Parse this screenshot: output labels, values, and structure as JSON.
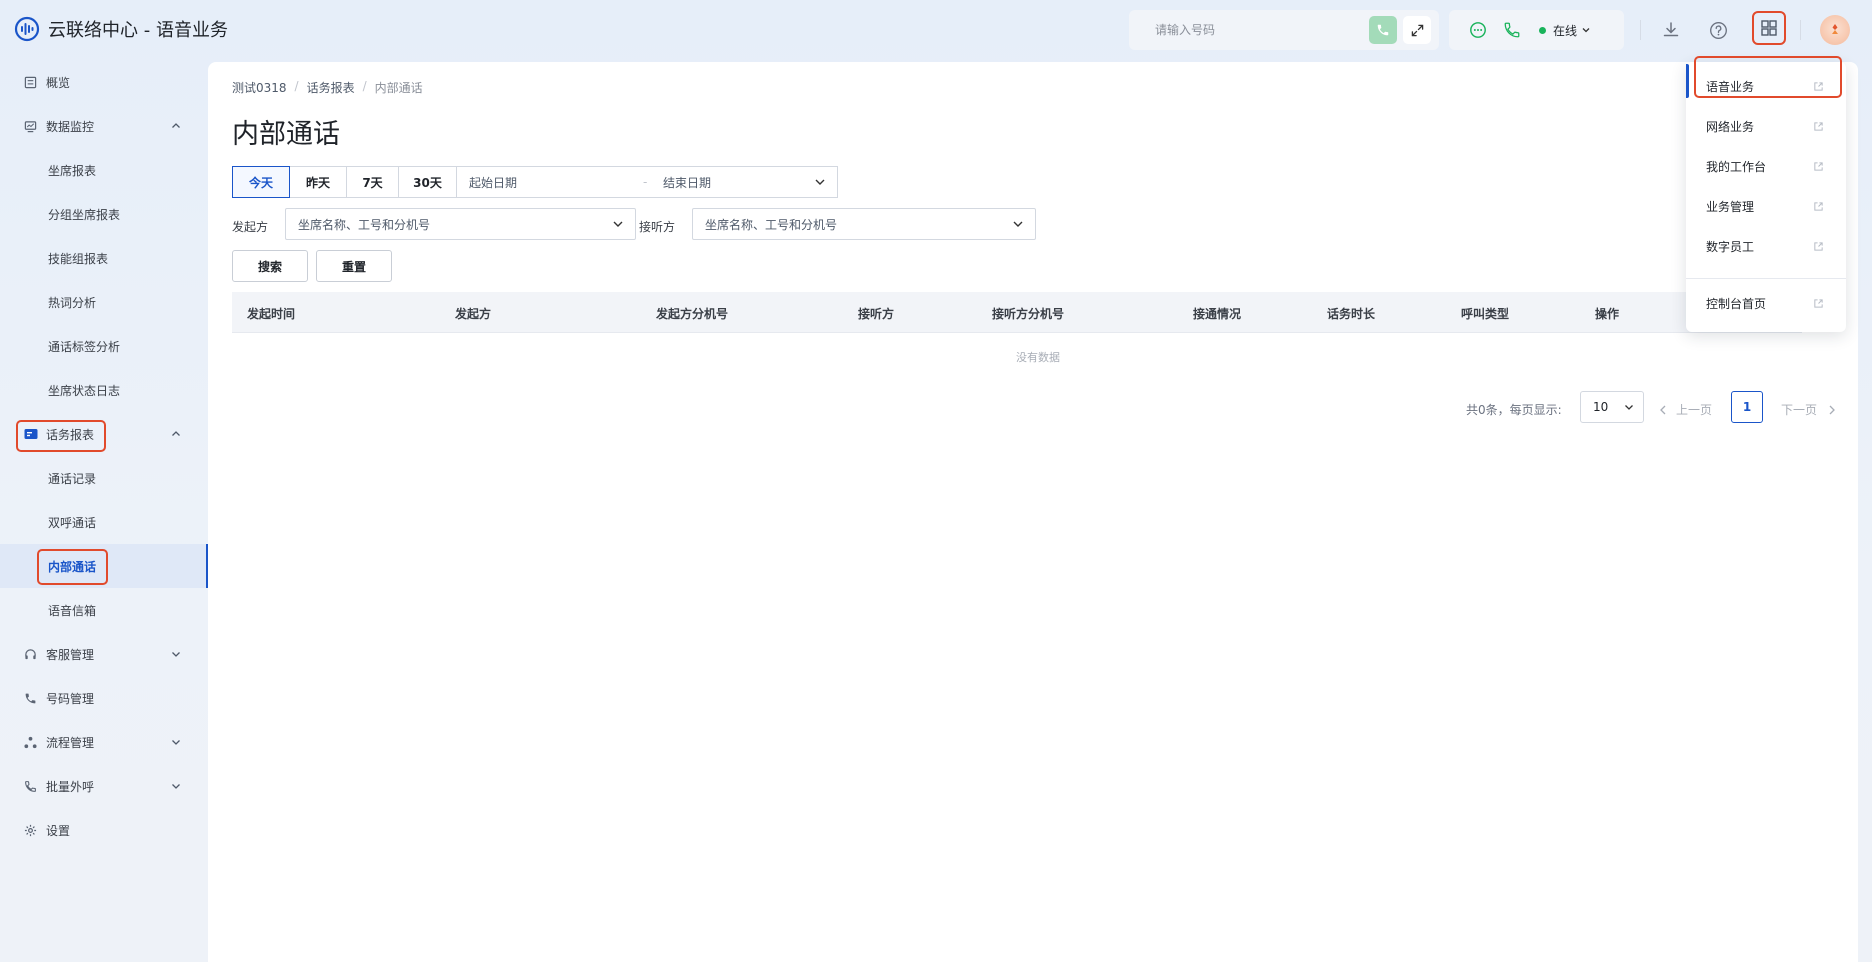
{
  "header": {
    "app_title": "云联络中心 - 语音业务",
    "phone_input": {
      "placeholder": "请输入号码",
      "value": ""
    },
    "status": {
      "label": "在线",
      "color": "#19b35b"
    },
    "icons": [
      "logo-icon",
      "phone-icon",
      "expand-icon",
      "chat-icon",
      "phone-call-icon",
      "chevron-down-icon",
      "download-icon",
      "help-icon",
      "apps-grid-icon",
      "avatar"
    ]
  },
  "sidebar": {
    "items": [
      {
        "label": "概览",
        "icon": "overview-icon"
      },
      {
        "label": "数据监控",
        "icon": "monitor-icon",
        "expanded": true
      },
      {
        "label": "坐席报表"
      },
      {
        "label": "分组坐席报表"
      },
      {
        "label": "技能组报表"
      },
      {
        "label": "热词分析"
      },
      {
        "label": "通话标签分析"
      },
      {
        "label": "坐席状态日志"
      },
      {
        "label": "话务报表",
        "icon": "report-icon",
        "expanded": true
      },
      {
        "label": "通话记录"
      },
      {
        "label": "双呼通话"
      },
      {
        "label": "内部通话",
        "active": true
      },
      {
        "label": "语音信箱"
      },
      {
        "label": "客服管理",
        "icon": "headset-icon"
      },
      {
        "label": "号码管理",
        "icon": "phone-icon"
      },
      {
        "label": "流程管理",
        "icon": "flow-icon"
      },
      {
        "label": "批量外呼",
        "icon": "outbound-icon"
      },
      {
        "label": "设置",
        "icon": "settings-icon"
      }
    ]
  },
  "breadcrumb": [
    "测试0318",
    "话务报表",
    "内部通话"
  ],
  "page_title": "内部通话",
  "date_filter": {
    "buttons": [
      "今天",
      "昨天",
      "7天",
      "30天"
    ],
    "active": "今天",
    "start_placeholder": "起始日期",
    "separator": "-",
    "end_placeholder": "结束日期"
  },
  "filters": {
    "caller_label": "发起方",
    "caller_placeholder": "坐席名称、工号和分机号",
    "callee_label": "接听方",
    "callee_placeholder": "坐席名称、工号和分机号"
  },
  "actions": {
    "search": "搜索",
    "reset": "重置"
  },
  "table": {
    "columns": [
      "发起时间",
      "发起方",
      "发起方分机号",
      "接听方",
      "接听方分机号",
      "接通情况",
      "话务时长",
      "呼叫类型",
      "操作"
    ],
    "rows": [],
    "empty_text": "没有数据"
  },
  "pagination": {
    "total_text": "共0条，每页显示:",
    "page_size": "10",
    "prev": "上一页",
    "current": "1",
    "next": "下一页"
  },
  "app_menu": {
    "items": [
      "语音业务",
      "网络业务",
      "我的工作台",
      "业务管理",
      "数字员工"
    ],
    "footer_item": "控制台首页",
    "active": "语音业务"
  },
  "colors": {
    "accent": "#1a55c9",
    "highlight": "#e14a2c",
    "online": "#19b35b"
  }
}
